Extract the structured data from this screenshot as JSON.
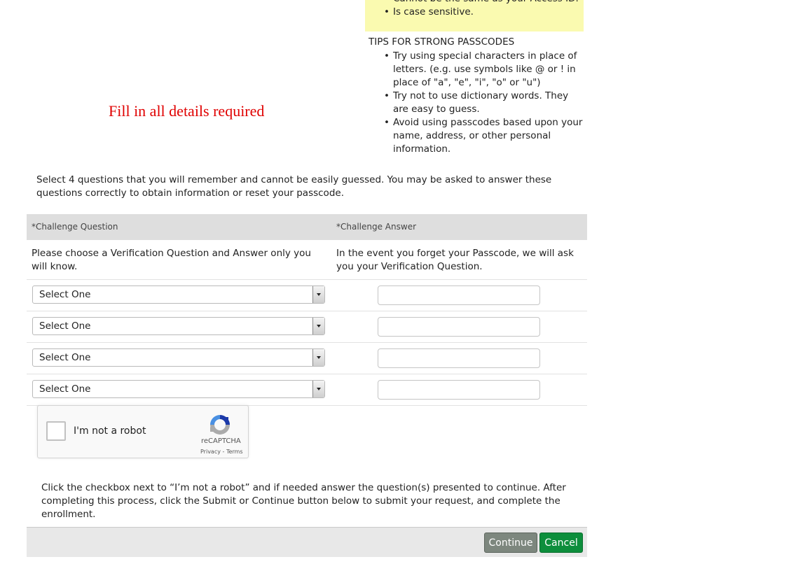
{
  "requirements_box": {
    "items": [
      "Cannot be the same as your Access ID.",
      "Is case sensitive."
    ],
    "background_color": "#fafab0"
  },
  "tips": {
    "title": "TIPS FOR STRONG PASSCODES",
    "items": [
      "Try using special characters in place of letters. (e.g. use symbols like @ or ! in place of \"a\", \"e\", \"i\", \"o\" or \"u\")",
      "Try not to use dictionary words. They are easy to guess.",
      "Avoid using passcodes based upon your name, address, or other personal information."
    ]
  },
  "fill_note": "Fill in all details required",
  "instructions": "Select 4 questions that you will remember and cannot be easily guessed. You may be asked to answer these questions correctly to obtain information or reset your passcode.",
  "challenge_table": {
    "question_header": "*Challenge Question",
    "answer_header": "*Challenge Answer",
    "question_hint": "Please choose a Verification Question and Answer only you will know.",
    "answer_hint": "In the event you forget your Passcode, we will ask you your Verification Question.",
    "rows": [
      {
        "selected": "Select One",
        "answer": ""
      },
      {
        "selected": "Select One",
        "answer": ""
      },
      {
        "selected": "Select One",
        "answer": ""
      },
      {
        "selected": "Select One",
        "answer": ""
      }
    ]
  },
  "recaptcha": {
    "label": "I'm not a robot",
    "brand": "reCAPTCHA",
    "links": "Privacy - Terms"
  },
  "captcha_help": "Click the checkbox next to “I’m not a robot” and if needed answer the question(s) presented to continue. After completing this process, click the Submit or Continue button below to submit your request, and complete the enrollment.",
  "buttons": {
    "continue_label": "Continue",
    "cancel_label": "Cancel",
    "continue_color": "#7d877e",
    "cancel_color": "#0d8e3c"
  },
  "colors": {
    "fill_note": "#e00000",
    "header_bg": "#dedede",
    "footer_bg": "#e8e8e8"
  }
}
